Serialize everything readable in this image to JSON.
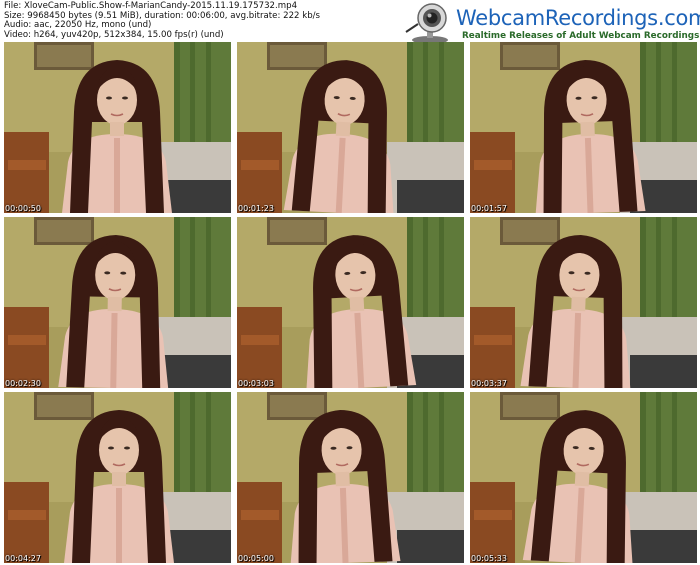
{
  "meta": {
    "file": "File: XloveCam-Public.Show-f-MarianCandy-2015.11.19.175732.mp4",
    "size": "Size: 9968450 bytes (9.51 MiB), duration: 00:06:00, avg.bitrate: 222 kb/s",
    "audio": "Audio: aac, 22050 Hz, mono (und)",
    "video": "Video: h264, yuv420p, 512x384, 15.00 fps(r) (und)"
  },
  "logo": {
    "title": "WebcamRecordings.com",
    "tagline": "Realtime Releases of Adult Webcam Recordings",
    "icon": "webcam-icon",
    "title_color": "#1d63b8",
    "tagline_color": "#2a6a2a"
  },
  "thumbnails": [
    {
      "timestamp": "00:00:50"
    },
    {
      "timestamp": "00:01:23"
    },
    {
      "timestamp": "00:01:57"
    },
    {
      "timestamp": "00:02:30"
    },
    {
      "timestamp": "00:03:03"
    },
    {
      "timestamp": "00:03:37"
    },
    {
      "timestamp": "00:04:27"
    },
    {
      "timestamp": "00:05:00"
    },
    {
      "timestamp": "00:05:33"
    }
  ]
}
